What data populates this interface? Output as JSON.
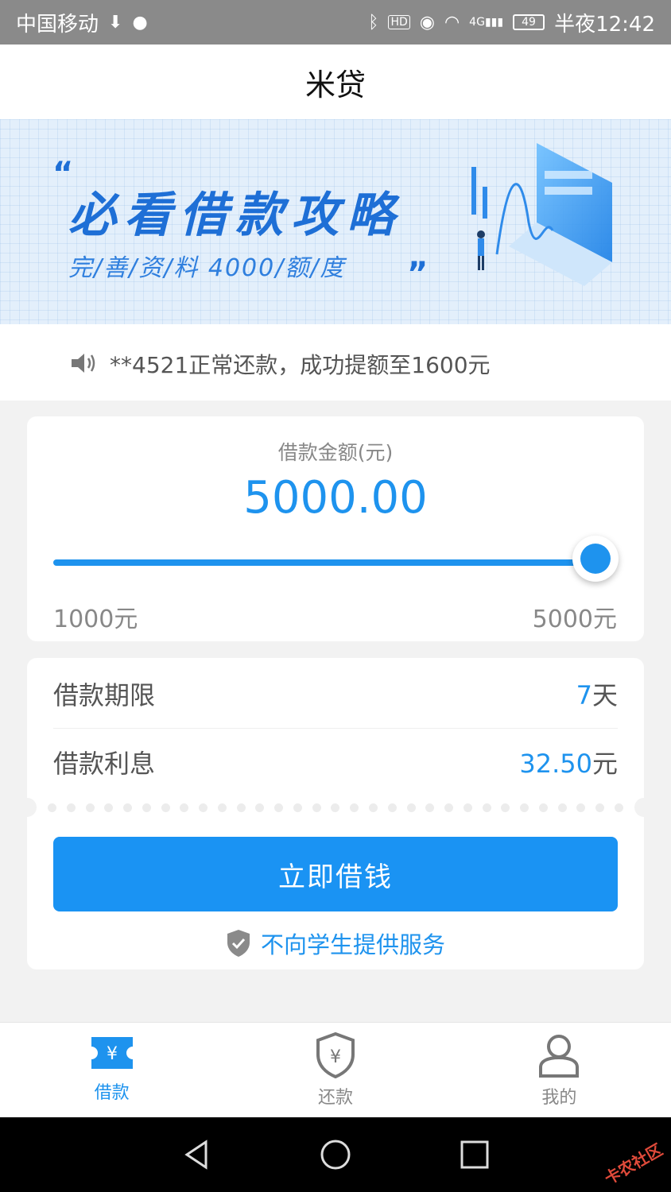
{
  "status_bar": {
    "carrier": "中国移动",
    "network": "4G",
    "battery": "49",
    "time": "半夜12:42"
  },
  "header": {
    "title": "米贷"
  },
  "banner": {
    "title": "必看借款攻略",
    "subtitle": "完/善/资/料  4000/额/度",
    "quote_open": "“",
    "quote_close": "”"
  },
  "notice": {
    "text": "**4521正常还款，成功提额至1600元"
  },
  "loan_amount": {
    "label": "借款金额(元)",
    "value": "5000.00",
    "slider_fraction": 1.0,
    "min_label": "1000元",
    "max_label": "5000元"
  },
  "details": {
    "term_label": "借款期限",
    "term_value": "7",
    "term_unit": "天",
    "interest_label": "借款利息",
    "interest_value": "32.50",
    "interest_unit": "元"
  },
  "borrow_button": {
    "label": "立即借钱"
  },
  "student_notice": {
    "text": "不向学生提供服务"
  },
  "tabs": [
    {
      "label": "借款",
      "icon": "ticket-yuan-icon",
      "active": true
    },
    {
      "label": "还款",
      "icon": "shield-yuan-icon",
      "active": false
    },
    {
      "label": "我的",
      "icon": "person-icon",
      "active": false
    }
  ],
  "watermark": "卡农社区",
  "colors": {
    "accent": "#1e93ee",
    "button": "#1a93f3",
    "banner_bg": "#e3effb",
    "banner_text": "#1e6fd6"
  }
}
